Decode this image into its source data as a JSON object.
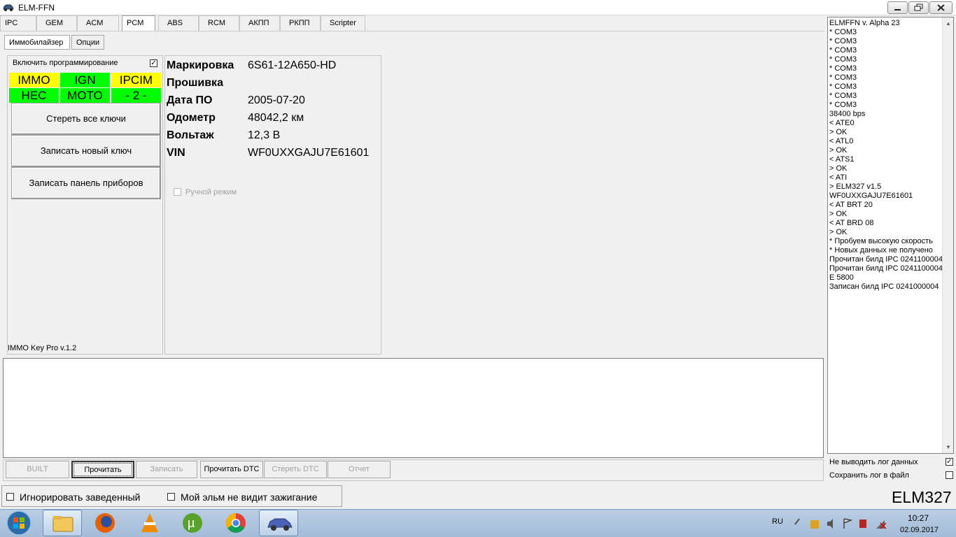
{
  "window": {
    "title": "ELM-FFN"
  },
  "tabs": [
    "IPC",
    "GEM",
    "ACM",
    "PCM",
    "ABS",
    "RCM",
    "АКПП",
    "РКПП",
    "Scripter"
  ],
  "active_tab": "PCM",
  "subtabs": [
    "Иммобилайзер",
    "Опции"
  ],
  "immo": {
    "enable_programming_label": "Включить программирование",
    "enable_programming_checked": "✓",
    "status": [
      "IMMO",
      "IGN",
      "IPCIM",
      "HEC",
      "MOTO",
      "- 2 -"
    ],
    "buttons": [
      "Стереть все ключи",
      "Записать новый ключ",
      "Записать панель приборов"
    ],
    "version": "IMMO Key Pro v.1.2"
  },
  "info": {
    "labels": [
      "Маркировка",
      "Прошивка",
      "Дата ПО",
      "Одометр",
      "Вольтаж",
      "VIN"
    ],
    "values": [
      "6S61-12A650-HD",
      "",
      "2005-07-20",
      "48042,2 км",
      "12,3 В",
      "WF0UXXGAJU7E61601"
    ],
    "manual_mode_label": "Ручной режим"
  },
  "actions": [
    "BUILT",
    "Прочитать",
    "Записать",
    "Прочитать DTC",
    "Стереть DTC",
    "Отчет"
  ],
  "log": {
    "lines": [
      "ELMFFN v. Alpha 23",
      "* COM3",
      "* COM3",
      "* COM3",
      "* COM3",
      "* COM3",
      "* COM3",
      "* COM3",
      "* COM3",
      "* COM3",
      "38400 bps",
      "< ATE0",
      "> OK",
      "< ATL0",
      "> OK",
      "< ATS1",
      "> OK",
      "< ATI",
      "> ELM327 v1.5",
      "WF0UXXGAJU7E61601",
      "< AT BRT 20",
      "> OK",
      "< AT BRD 08",
      "> OK",
      "* Пробуем высокую скорость",
      "* Новых данных не получено",
      "Прочитан билд IPC 0241100004",
      "Прочитан билд IPC 0241100004",
      "E 5800",
      "Записан билд IPC 0241000004"
    ],
    "no_log_label": "Не выводить лог данных",
    "no_log_checked": "✓",
    "save_log_label": "Сохранить лог в файл"
  },
  "bottom": {
    "ignore_label": "Игнорировать заведенный",
    "no_ignition_label": "Мой эльм не видит зажигание",
    "adapter": "ELM327"
  },
  "taskbar": {
    "lang": "RU",
    "time": "10:27",
    "date": "02.09.2017"
  }
}
